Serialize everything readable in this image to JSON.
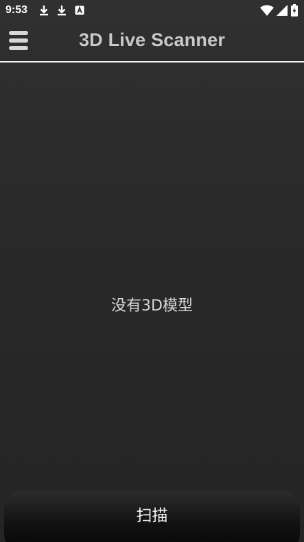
{
  "status_bar": {
    "time": "9:53",
    "left_icons": [
      "download-icon",
      "download-icon",
      "a-badge-icon"
    ],
    "right_icons": [
      "wifi-icon",
      "signal-icon",
      "battery-charging-icon"
    ]
  },
  "app_bar": {
    "menu_icon": "hamburger-menu-icon",
    "title": "3D Live Scanner"
  },
  "main": {
    "empty_message": "没有3D模型"
  },
  "bottom": {
    "scan_label": "扫描"
  },
  "colors": {
    "background": "#262626",
    "title_text": "#c9c9c9",
    "divider": "#f2f2f2"
  }
}
